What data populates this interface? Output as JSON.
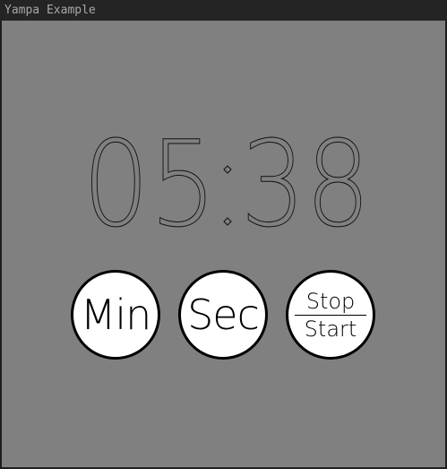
{
  "window": {
    "title": "Yampa Example"
  },
  "timer": {
    "minutes": "05",
    "separator": ":",
    "seconds": "38"
  },
  "buttons": {
    "min_label": "Min",
    "sec_label": "Sec",
    "stop_label": "Stop",
    "start_label": "Start"
  },
  "colors": {
    "background": "#808080",
    "button_fill": "#ffffff",
    "outline": "#000000",
    "titlebar": "#242424"
  }
}
